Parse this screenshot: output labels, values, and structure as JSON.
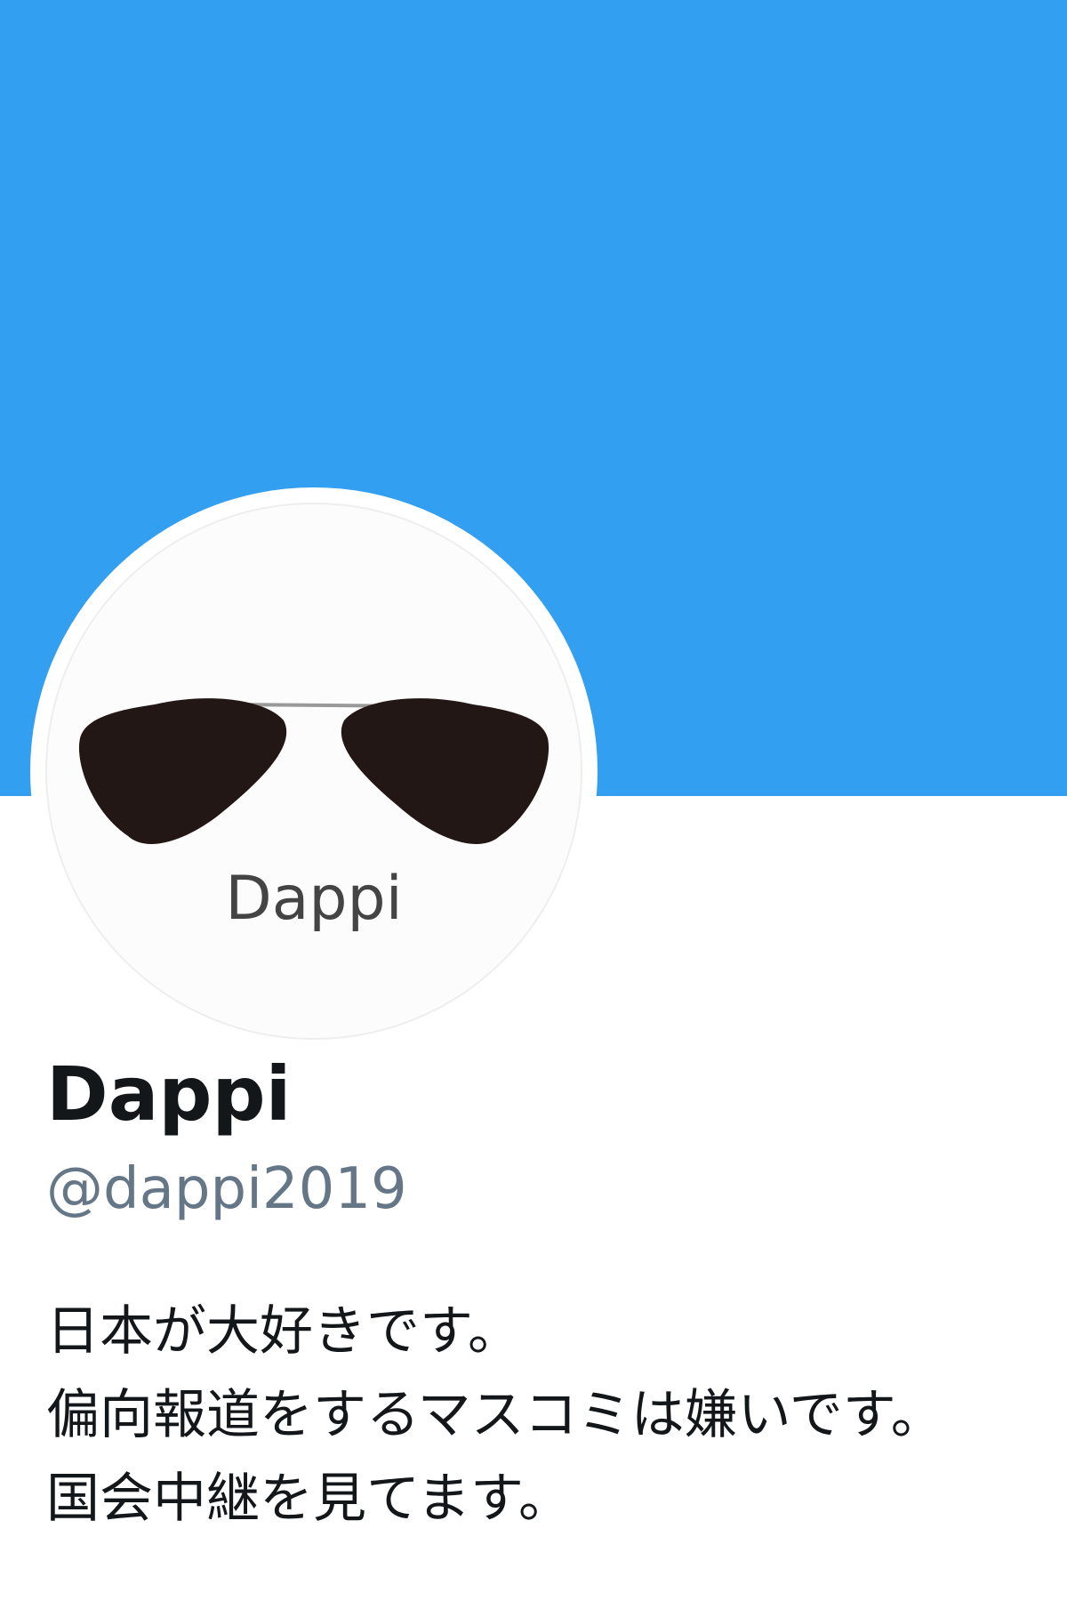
{
  "profile": {
    "banner_color": "#339ff0",
    "avatar_text": "Dappi",
    "display_name": "Dappi",
    "handle": "@dappi2019",
    "bio_lines": [
      "日本が大好きです。",
      "偏向報道をするマスコミは嫌いです。",
      "国会中継を見てます。"
    ]
  },
  "icons": {
    "avatar": "sunglasses-icon"
  }
}
